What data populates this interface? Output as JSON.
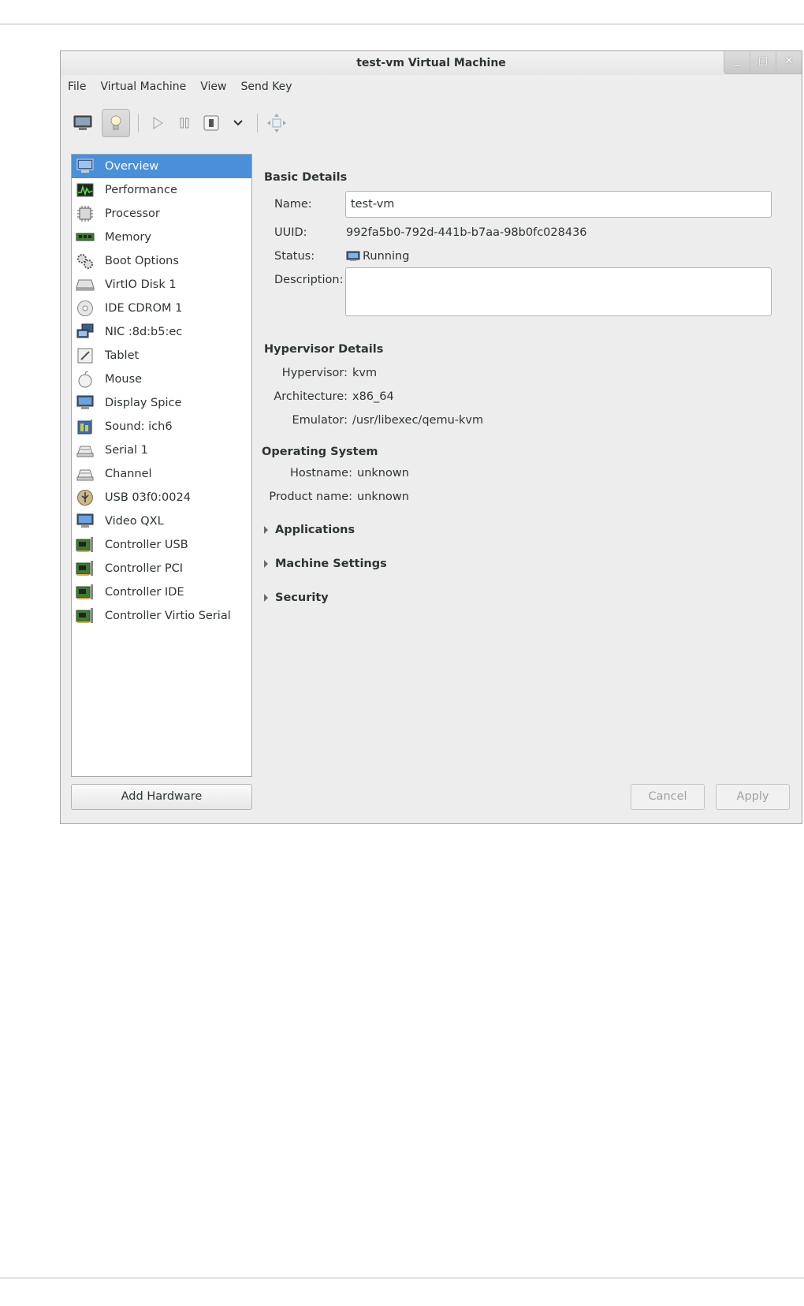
{
  "window": {
    "title": "test-vm Virtual Machine"
  },
  "menubar": [
    "File",
    "Virtual Machine",
    "View",
    "Send Key"
  ],
  "toolbar": {
    "buttons": [
      "console-icon",
      "lightbulb-icon",
      "play-icon",
      "pause-icon",
      "shutdown-icon",
      "chevron-down-icon",
      "fullscreen-icon"
    ]
  },
  "sidebar": {
    "items": [
      {
        "label": "Overview",
        "icon": "monitor-icon"
      },
      {
        "label": "Performance",
        "icon": "performance-graph-icon"
      },
      {
        "label": "Processor",
        "icon": "cpu-chip-icon"
      },
      {
        "label": "Memory",
        "icon": "memory-module-icon"
      },
      {
        "label": "Boot Options",
        "icon": "gears-icon"
      },
      {
        "label": "VirtIO Disk 1",
        "icon": "hard-disk-icon"
      },
      {
        "label": "IDE CDROM 1",
        "icon": "cdrom-icon"
      },
      {
        "label": "NIC :8d:b5:ec",
        "icon": "network-icon"
      },
      {
        "label": "Tablet",
        "icon": "tablet-icon"
      },
      {
        "label": "Mouse",
        "icon": "mouse-icon"
      },
      {
        "label": "Display Spice",
        "icon": "display-icon"
      },
      {
        "label": "Sound: ich6",
        "icon": "sound-card-icon"
      },
      {
        "label": "Serial 1",
        "icon": "serial-port-icon"
      },
      {
        "label": "Channel",
        "icon": "channel-icon"
      },
      {
        "label": "USB 03f0:0024",
        "icon": "usb-icon"
      },
      {
        "label": "Video QXL",
        "icon": "video-icon"
      },
      {
        "label": "Controller USB",
        "icon": "controller-card-icon"
      },
      {
        "label": "Controller PCI",
        "icon": "controller-card-icon"
      },
      {
        "label": "Controller IDE",
        "icon": "controller-card-icon"
      },
      {
        "label": "Controller Virtio Serial",
        "icon": "controller-card-icon"
      }
    ],
    "selected_index": 0,
    "add_hardware_label": "Add Hardware"
  },
  "basic": {
    "heading": "Basic Details",
    "name_label": "Name:",
    "name_value": "test-vm",
    "uuid_label": "UUID:",
    "uuid_value": "992fa5b0-792d-441b-b7aa-98b0fc028436",
    "status_label": "Status:",
    "status_value": "Running",
    "description_label": "Description:",
    "description_value": ""
  },
  "hypervisor": {
    "heading": "Hypervisor Details",
    "hypervisor_label": "Hypervisor:",
    "hypervisor_value": "kvm",
    "arch_label": "Architecture:",
    "arch_value": "x86_64",
    "emulator_label": "Emulator:",
    "emulator_value": "/usr/libexec/qemu-kvm"
  },
  "os": {
    "heading": "Operating System",
    "hostname_label": "Hostname:",
    "hostname_value": "unknown",
    "product_label": "Product name:",
    "product_value": "unknown"
  },
  "expanders": [
    "Applications",
    "Machine Settings",
    "Security"
  ],
  "footer": {
    "cancel_label": "Cancel",
    "apply_label": "Apply"
  },
  "colors": {
    "selection": "#4a90d9",
    "window_bg": "#ededed"
  }
}
